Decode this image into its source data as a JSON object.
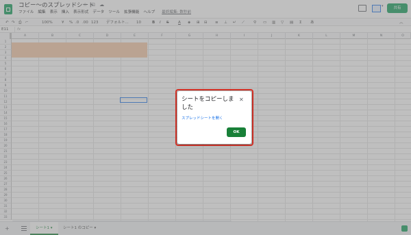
{
  "app": {
    "doc_title": "コピー〜のスプレッドシート",
    "title_icons": [
      "star-icon",
      "move-folder-icon",
      "cloud-status-icon"
    ],
    "menu": [
      "ファイル",
      "編集",
      "表示",
      "挿入",
      "表示形式",
      "データ",
      "ツール",
      "拡張機能",
      "ヘルプ"
    ],
    "last_edit": "最終編集: 数秒前",
    "share_label": "共有",
    "brand_color": "#0f9d58"
  },
  "toolbar": {
    "zoom": "100%",
    "currency": "¥",
    "percent": "%",
    "decimal_dec": ".0",
    "decimal_inc": ".00",
    "number_format": "123",
    "font": "デフォルト...",
    "font_size": "10"
  },
  "formula_bar": {
    "cell_ref": "E11",
    "fx": "fx"
  },
  "grid": {
    "columns": [
      "A",
      "B",
      "C",
      "D",
      "E",
      "F",
      "G",
      "H",
      "I",
      "J",
      "K",
      "L",
      "M",
      "N",
      "O"
    ],
    "rows": [
      "1",
      "2",
      "3",
      "4",
      "5",
      "6",
      "7",
      "8",
      "9",
      "10",
      "11",
      "12",
      "13",
      "14",
      "15",
      "16",
      "17",
      "18",
      "19",
      "20",
      "21",
      "22",
      "23",
      "24",
      "25",
      "26",
      "27",
      "28",
      "29",
      "30",
      "31",
      "32",
      "33"
    ],
    "highlight_color": "#f4c7a5"
  },
  "sheets": {
    "tabs": [
      "シート1 ▾",
      "シート1 のコピー ▾"
    ],
    "active_index": 0
  },
  "dialog": {
    "title": "シートをコピーしました",
    "close_icon": "close-icon",
    "link": "スプレッドシートを開く",
    "ok_label": "OK",
    "frame_color": "#d93025"
  }
}
